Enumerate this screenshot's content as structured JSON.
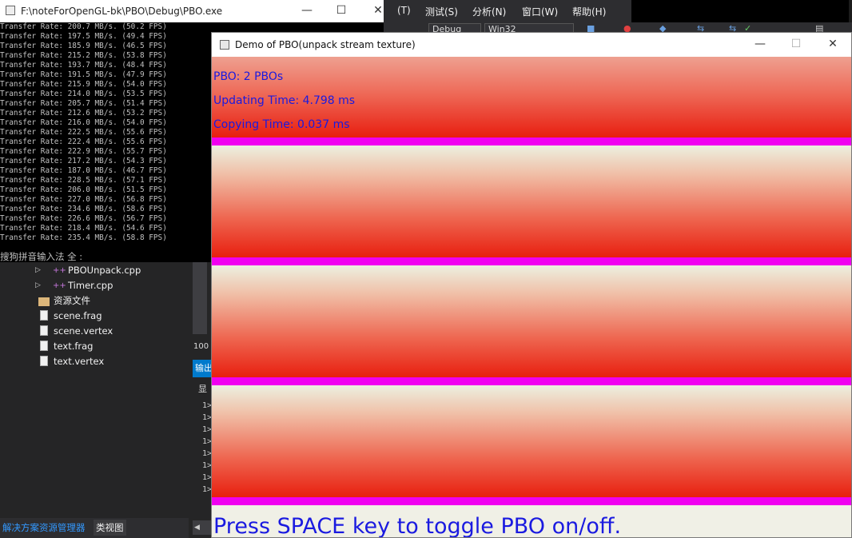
{
  "vs": {
    "menu": [
      "(T)",
      "测试(S)",
      "分析(N)",
      "窗口(W)",
      "帮助(H)"
    ],
    "config_combo": "Debug",
    "platform_combo": "Win32"
  },
  "console": {
    "title": "F:\\noteForOpenGL-bk\\PBO\\Debug\\PBO.exe",
    "lines": [
      "Transfer Rate: 200.7 MB/s. (50.2 FPS)",
      "Transfer Rate: 197.5 MB/s. (49.4 FPS)",
      "Transfer Rate: 185.9 MB/s. (46.5 FPS)",
      "Transfer Rate: 215.2 MB/s. (53.8 FPS)",
      "Transfer Rate: 193.7 MB/s. (48.4 FPS)",
      "Transfer Rate: 191.5 MB/s. (47.9 FPS)",
      "Transfer Rate: 215.9 MB/s. (54.0 FPS)",
      "Transfer Rate: 214.0 MB/s. (53.5 FPS)",
      "Transfer Rate: 205.7 MB/s. (51.4 FPS)",
      "Transfer Rate: 212.6 MB/s. (53.2 FPS)",
      "Transfer Rate: 216.0 MB/s. (54.0 FPS)",
      "Transfer Rate: 222.5 MB/s. (55.6 FPS)",
      "Transfer Rate: 222.4 MB/s. (55.6 FPS)",
      "Transfer Rate: 222.9 MB/s. (55.7 FPS)",
      "Transfer Rate: 217.2 MB/s. (54.3 FPS)",
      "Transfer Rate: 187.0 MB/s. (46.7 FPS)",
      "Transfer Rate: 228.5 MB/s. (57.1 FPS)",
      "Transfer Rate: 206.0 MB/s. (51.5 FPS)",
      "Transfer Rate: 227.0 MB/s. (56.8 FPS)",
      "Transfer Rate: 234.6 MB/s. (58.6 FPS)",
      "Transfer Rate: 226.6 MB/s. (56.7 FPS)",
      "Transfer Rate: 218.4 MB/s. (54.6 FPS)",
      "Transfer Rate: 235.4 MB/s. (58.8 FPS)"
    ],
    "ime": "搜狗拼音输入法 全 :"
  },
  "solution": {
    "items": [
      "PBOUnpack.cpp",
      "Timer.cpp",
      "资源文件",
      "scene.frag",
      "scene.vertex",
      "text.frag",
      "text.vertex"
    ],
    "tabs": [
      "解决方案资源管理器",
      "类视图"
    ]
  },
  "midpanel": {
    "zoom": "100",
    "output_tab": "输出",
    "show": "显",
    "line_prefix": "1>"
  },
  "demo": {
    "title": "Demo of PBO(unpack stream texture)",
    "pbo": "PBO: 2 PBOs",
    "updating": "Updating Time: 4.798 ms",
    "copying": "Copying Time: 0.037 ms",
    "press": "Press SPACE key to toggle PBO on/off."
  },
  "colors": {
    "text_blue": "#1a1ae0",
    "stripe_magenta": "#f000f0",
    "gradient_red": "#e81f0f"
  }
}
